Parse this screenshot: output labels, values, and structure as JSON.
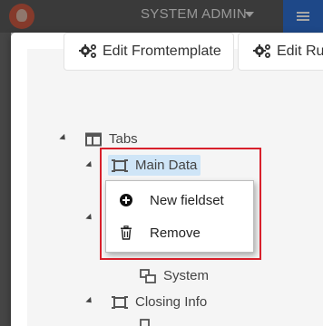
{
  "header": {
    "user_menu_label": "SYSTEM ADMIN"
  },
  "toolbar": {
    "edit_fromtemplate_label": "Edit Fromtemplate",
    "edit_rules_label": "Edit Rul"
  },
  "tree": {
    "root": {
      "label": "Tabs",
      "icon": "tab-panel-icon"
    },
    "items": [
      {
        "label": "Main Data",
        "icon": "fieldset-icon",
        "selected": true
      },
      {
        "label": "System",
        "icon": "field-group-icon"
      },
      {
        "label": "Closing Info",
        "icon": "fieldset-icon"
      }
    ]
  },
  "context_menu": {
    "items": [
      {
        "label": "New fieldset",
        "icon": "plus-circle-icon"
      },
      {
        "label": "Remove",
        "icon": "trash-icon"
      }
    ]
  },
  "colors": {
    "highlight": "#d8202b",
    "selection": "#cfe5f7",
    "menu_button": "#2e6fd1"
  }
}
